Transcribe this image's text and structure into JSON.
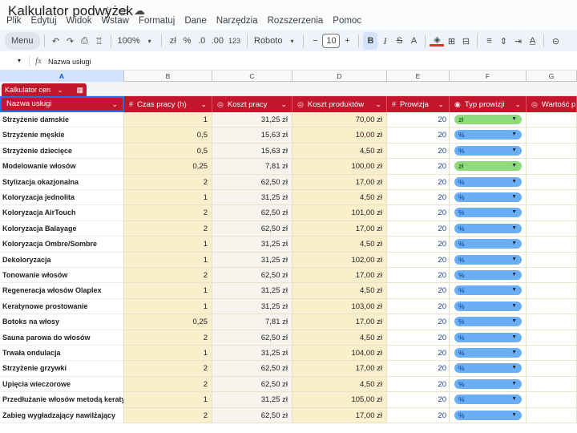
{
  "window": {
    "title": "Kalkulator podwyżek",
    "icons": [
      "star-icon",
      "folder-icon",
      "cloud-icon"
    ]
  },
  "menu": [
    "Plik",
    "Edytuj",
    "Widok",
    "Wstaw",
    "Formatuj",
    "Dane",
    "Narzędzia",
    "Rozszerzenia",
    "Pomoc"
  ],
  "toolbar": {
    "menu_label": "Menu",
    "zoom": "100%",
    "currency": "zł",
    "percent": "%",
    "dec_minus": ".0",
    "dec_plus": ".00",
    "number_format": "123",
    "font": "Roboto",
    "font_size": "10",
    "minus": "−",
    "plus": "+",
    "bold": "B",
    "italic": "I",
    "strike": "S",
    "text_color": "A"
  },
  "formula_bar": {
    "fx": "fx",
    "content": "Nazwa usługi"
  },
  "columns": [
    "A",
    "B",
    "C",
    "D",
    "E",
    "F",
    "G"
  ],
  "table_tab": {
    "label": "Kalkulator cen"
  },
  "headers": {
    "A": "Nazwa usługi",
    "B": "Czas pracy (h)",
    "C": "Koszt pracy",
    "D": "Koszt produktów",
    "E": "Prowizja",
    "F": "Typ prowizji",
    "G": "Wartość p"
  },
  "rows": [
    {
      "name": "Strzyżenie damskie",
      "time": "1",
      "labor": "31,25 zł",
      "products": "70,00 zł",
      "commission": "20",
      "type": "zł"
    },
    {
      "name": "Strzyżenie męskie",
      "time": "0,5",
      "labor": "15,63 zł",
      "products": "10,00 zł",
      "commission": "20",
      "type": "%"
    },
    {
      "name": "Strzyżenie dziecięce",
      "time": "0,5",
      "labor": "15,63 zł",
      "products": "4,50 zł",
      "commission": "20",
      "type": "%"
    },
    {
      "name": "Modelowanie włosów",
      "time": "0,25",
      "labor": "7,81 zł",
      "products": "100,00 zł",
      "commission": "20",
      "type": "zł"
    },
    {
      "name": "Stylizacja okazjonalna",
      "time": "2",
      "labor": "62,50 zł",
      "products": "17,00 zł",
      "commission": "20",
      "type": "%"
    },
    {
      "name": "Koloryzacja jednolita",
      "time": "1",
      "labor": "31,25 zł",
      "products": "4,50 zł",
      "commission": "20",
      "type": "%"
    },
    {
      "name": "Koloryzacja AirTouch",
      "time": "2",
      "labor": "62,50 zł",
      "products": "101,00 zł",
      "commission": "20",
      "type": "%"
    },
    {
      "name": "Koloryzacja Balayage",
      "time": "2",
      "labor": "62,50 zł",
      "products": "17,00 zł",
      "commission": "20",
      "type": "%"
    },
    {
      "name": "Koloryzacja Ombre/Sombre",
      "time": "1",
      "labor": "31,25 zł",
      "products": "4,50 zł",
      "commission": "20",
      "type": "%"
    },
    {
      "name": "Dekoloryzacja",
      "time": "1",
      "labor": "31,25 zł",
      "products": "102,00 zł",
      "commission": "20",
      "type": "%"
    },
    {
      "name": "Tonowanie włosów",
      "time": "2",
      "labor": "62,50 zł",
      "products": "17,00 zł",
      "commission": "20",
      "type": "%"
    },
    {
      "name": "Regeneracja włosów Olaplex",
      "time": "1",
      "labor": "31,25 zł",
      "products": "4,50 zł",
      "commission": "20",
      "type": "%"
    },
    {
      "name": "Keratynowe prostowanie",
      "time": "1",
      "labor": "31,25 zł",
      "products": "103,00 zł",
      "commission": "20",
      "type": "%"
    },
    {
      "name": "Botoks na włosy",
      "time": "0,25",
      "labor": "7,81 zł",
      "products": "17,00 zł",
      "commission": "20",
      "type": "%"
    },
    {
      "name": "Sauna parowa do włosów",
      "time": "2",
      "labor": "62,50 zł",
      "products": "4,50 zł",
      "commission": "20",
      "type": "%"
    },
    {
      "name": "Trwała ondulacja",
      "time": "1",
      "labor": "31,25 zł",
      "products": "104,00 zł",
      "commission": "20",
      "type": "%"
    },
    {
      "name": "Strzyżenie grzywki",
      "time": "2",
      "labor": "62,50 zł",
      "products": "17,00 zł",
      "commission": "20",
      "type": "%"
    },
    {
      "name": "Upięcia wieczorowe",
      "time": "2",
      "labor": "62,50 zł",
      "products": "4,50 zł",
      "commission": "20",
      "type": "%"
    },
    {
      "name": "Przedłużanie włosów metodą keratynową",
      "time": "1",
      "labor": "31,25 zł",
      "products": "105,00 zł",
      "commission": "20",
      "type": "%"
    },
    {
      "name": "Zabieg wygładzający nawilżający",
      "time": "2",
      "labor": "62,50 zł",
      "products": "17,00 zł",
      "commission": "20",
      "type": "%"
    }
  ],
  "colors": {
    "header_red": "#c4162a",
    "chip_percent": "#6aaef5",
    "chip_currency": "#8ddb7a",
    "cell_yellow": "#fbeecb"
  }
}
